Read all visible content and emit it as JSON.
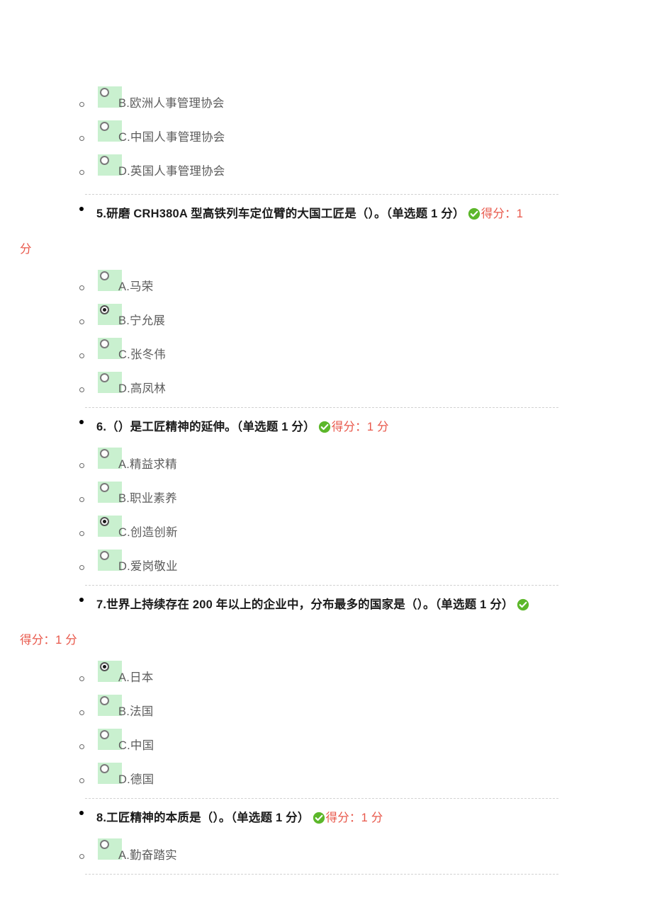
{
  "document": {
    "type": "exam-result",
    "colors": {
      "option_highlight": "#c9f0cf",
      "score_text": "#e8574a",
      "check_icon": "#5cb72a",
      "option_text": "#5d5d5d",
      "question_text": "#1c1c1c",
      "divider": "#d2d2d2"
    }
  },
  "partial_question_options": [
    {
      "label": "B.欧洲人事管理协会",
      "selected": false
    },
    {
      "label": "C.中国人事管理协会",
      "selected": false
    },
    {
      "label": "D.英国人事管理协会",
      "selected": false
    }
  ],
  "questions": [
    {
      "number": "5.",
      "stem": "研磨 CRH380A 型高铁列车定位臂的大国工匠是（）。",
      "meta": "（单选题 1 分）",
      "score_label": "得分：",
      "score_value": "1 分",
      "score_line1": "得分：1",
      "score_line2": "分",
      "wraps": true,
      "icon": "check-circle-icon",
      "options": [
        {
          "label": "A.马荣",
          "selected": false
        },
        {
          "label": "B.宁允展",
          "selected": true
        },
        {
          "label": "C.张冬伟",
          "selected": false
        },
        {
          "label": "D.高凤林",
          "selected": false
        }
      ]
    },
    {
      "number": "6.",
      "stem": "（）是工匠精神的延伸。",
      "meta": "（单选题 1 分）",
      "score_label": "得分：",
      "score_value": "1 分",
      "score_line1": "得分：1 分",
      "score_line2": "",
      "wraps": false,
      "icon": "check-circle-icon",
      "options": [
        {
          "label": "A.精益求精",
          "selected": false
        },
        {
          "label": "B.职业素养",
          "selected": false
        },
        {
          "label": "C.创造创新",
          "selected": true
        },
        {
          "label": "D.爱岗敬业",
          "selected": false
        }
      ]
    },
    {
      "number": "7.",
      "stem": "世界上持续存在 200 年以上的企业中，分布最多的国家是（）。",
      "meta": "（单选题 1 分）",
      "score_label": "得分：",
      "score_value": "1 分",
      "score_line1": "",
      "score_line2": "得分：1 分",
      "wraps": true,
      "icon": "check-circle-icon",
      "options": [
        {
          "label": "A.日本",
          "selected": true
        },
        {
          "label": "B.法国",
          "selected": false
        },
        {
          "label": "C.中国",
          "selected": false
        },
        {
          "label": "D.德国",
          "selected": false
        }
      ]
    },
    {
      "number": "8.",
      "stem": "工匠精神的本质是（）。",
      "meta": "（单选题 1 分）",
      "score_label": "得分：",
      "score_value": "1 分",
      "score_line1": "得分：1 分",
      "score_line2": "",
      "wraps": false,
      "icon": "check-circle-icon",
      "options": [
        {
          "label": "A.勤奋踏实",
          "selected": false
        }
      ]
    }
  ]
}
